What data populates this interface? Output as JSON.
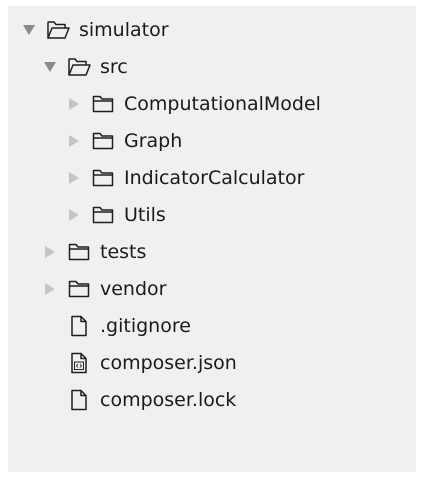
{
  "tree": {
    "root": {
      "label": "simulator",
      "expanded": true,
      "icon": "folder-open-icon"
    },
    "src": {
      "label": "src",
      "expanded": true,
      "icon": "folder-open-icon",
      "children": [
        {
          "label": "ComputationalModel",
          "icon": "folder-icon",
          "expanded": false
        },
        {
          "label": "Graph",
          "icon": "folder-icon",
          "expanded": false
        },
        {
          "label": "IndicatorCalculator",
          "icon": "folder-icon",
          "expanded": false
        },
        {
          "label": "Utils",
          "icon": "folder-icon",
          "expanded": false
        }
      ]
    },
    "folders": [
      {
        "label": "tests",
        "icon": "folder-icon",
        "expanded": false
      },
      {
        "label": "vendor",
        "icon": "folder-icon",
        "expanded": false
      }
    ],
    "files": [
      {
        "label": ".gitignore",
        "icon": "file-icon"
      },
      {
        "label": "composer.json",
        "icon": "json-file-icon"
      },
      {
        "label": "composer.lock",
        "icon": "file-icon"
      }
    ]
  },
  "colors": {
    "panel_background": "#f0f0f0",
    "text": "#1a1a1a",
    "expanded_arrow": "#8a8a8a",
    "collapsed_arrow": "#c4c4c4",
    "icon_stroke": "#1e1e1e"
  }
}
